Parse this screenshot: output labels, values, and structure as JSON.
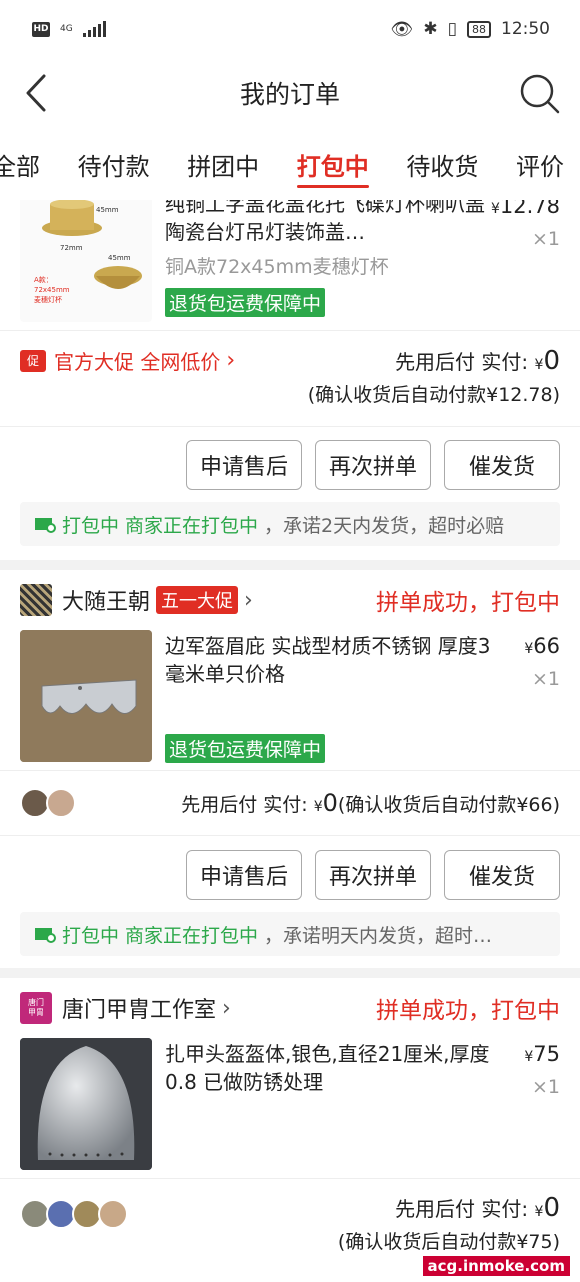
{
  "statusbar": {
    "hd": "HD",
    "network": "4G",
    "battery": "88",
    "time": "12:50"
  },
  "header": {
    "title": "我的订单"
  },
  "tabs": [
    {
      "label": "全部"
    },
    {
      "label": "待付款"
    },
    {
      "label": "拼团中"
    },
    {
      "label": "打包中"
    },
    {
      "label": "待收货"
    },
    {
      "label": "评价"
    }
  ],
  "orders": [
    {
      "product_name": "纯铜工字盖花盖花托飞碟灯杯喇叭盖陶瓷台灯吊灯装饰盖…",
      "spec": "铜A款72x45mm麦穗灯杯",
      "price_symbol": "¥",
      "price": "12.78",
      "qty": "×1",
      "guarantee": "退货包运费保障中",
      "image_labels": {
        "h": "45mm",
        "w": "72mm",
        "w2": "45mm",
        "caption": "A款：\n72x45mm\n麦穗灯杯"
      },
      "promo_badge": "促",
      "promo_text": "官方大促 全网低价",
      "pay_label": "先用后付 实付:",
      "pay_symbol": "¥",
      "pay_amount": "0",
      "pay_note": "(确认收货后自动付款¥12.78)",
      "buttons": [
        "申请售后",
        "再次拼单",
        "催发货"
      ],
      "notice_status": "打包中",
      "notice_merchant": "商家正在打包中",
      "notice_text": "，承诺2天内发货，超时必赔"
    },
    {
      "shop_name": "大随王朝",
      "shop_promo": "五一大促",
      "status": "拼单成功，打包中",
      "product_name": "边军盔眉庇 实战型材质不锈钢 厚度3毫米单只价格",
      "price_symbol": "¥",
      "price": "66",
      "qty": "×1",
      "guarantee": "退货包运费保障中",
      "pay_label": "先用后付 实付:",
      "pay_symbol": "¥",
      "pay_amount": "0",
      "pay_note": "(确认收货后自动付款¥66)",
      "buttons": [
        "申请售后",
        "再次拼单",
        "催发货"
      ],
      "notice_status": "打包中",
      "notice_merchant": "商家正在打包中",
      "notice_text": "，承诺明天内发货，超时…"
    },
    {
      "shop_name": "唐门甲胄工作室",
      "shop_logo_text": "唐门\n甲胄",
      "status": "拼单成功，打包中",
      "product_name": "扎甲头盔盔体,银色,直径21厘米,厚度0.8 已做防锈处理",
      "price_symbol": "¥",
      "price": "75",
      "qty": "×1",
      "pay_label": "先用后付 实付:",
      "pay_symbol": "¥",
      "pay_amount": "0",
      "pay_note": "(确认收货后自动付款¥75)"
    }
  ],
  "watermark": "acg.inmoke.com",
  "colors": {
    "accent": "#e02e24",
    "green": "#2ca84a"
  }
}
